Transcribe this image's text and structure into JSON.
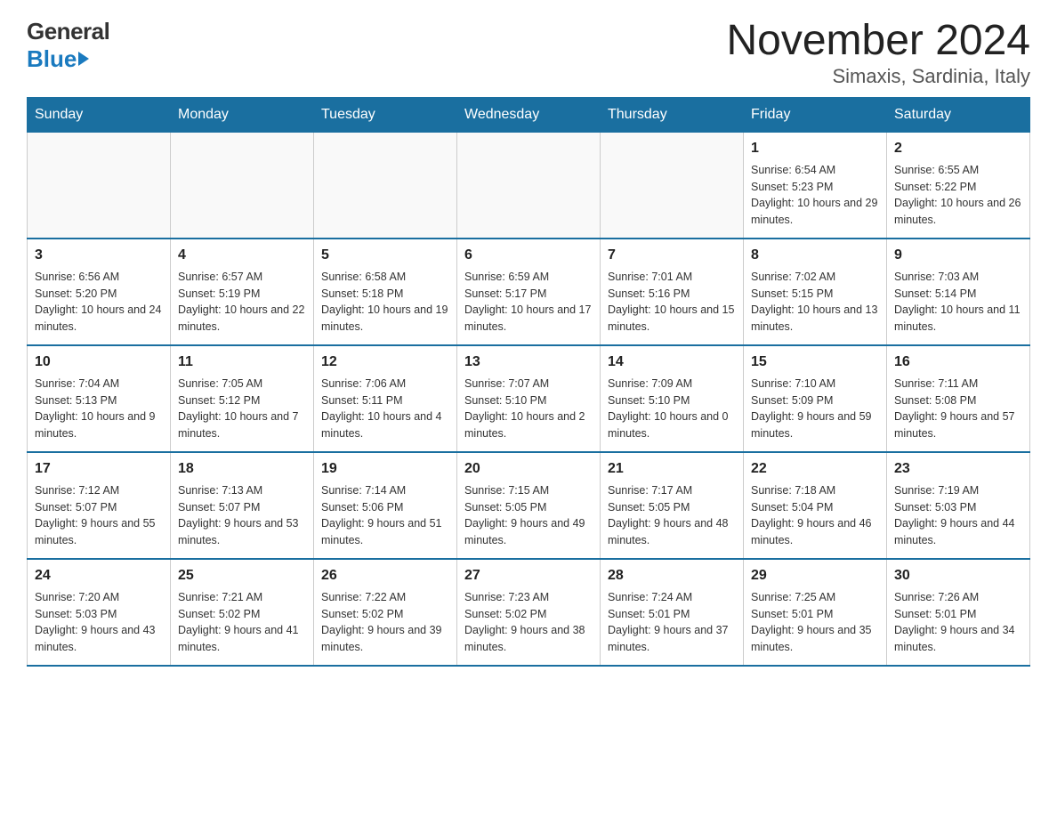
{
  "header": {
    "logo_general": "General",
    "logo_blue": "Blue",
    "month_title": "November 2024",
    "location": "Simaxis, Sardinia, Italy"
  },
  "days_of_week": [
    "Sunday",
    "Monday",
    "Tuesday",
    "Wednesday",
    "Thursday",
    "Friday",
    "Saturday"
  ],
  "weeks": [
    [
      {
        "day": "",
        "info": ""
      },
      {
        "day": "",
        "info": ""
      },
      {
        "day": "",
        "info": ""
      },
      {
        "day": "",
        "info": ""
      },
      {
        "day": "",
        "info": ""
      },
      {
        "day": "1",
        "info": "Sunrise: 6:54 AM\nSunset: 5:23 PM\nDaylight: 10 hours and 29 minutes."
      },
      {
        "day": "2",
        "info": "Sunrise: 6:55 AM\nSunset: 5:22 PM\nDaylight: 10 hours and 26 minutes."
      }
    ],
    [
      {
        "day": "3",
        "info": "Sunrise: 6:56 AM\nSunset: 5:20 PM\nDaylight: 10 hours and 24 minutes."
      },
      {
        "day": "4",
        "info": "Sunrise: 6:57 AM\nSunset: 5:19 PM\nDaylight: 10 hours and 22 minutes."
      },
      {
        "day": "5",
        "info": "Sunrise: 6:58 AM\nSunset: 5:18 PM\nDaylight: 10 hours and 19 minutes."
      },
      {
        "day": "6",
        "info": "Sunrise: 6:59 AM\nSunset: 5:17 PM\nDaylight: 10 hours and 17 minutes."
      },
      {
        "day": "7",
        "info": "Sunrise: 7:01 AM\nSunset: 5:16 PM\nDaylight: 10 hours and 15 minutes."
      },
      {
        "day": "8",
        "info": "Sunrise: 7:02 AM\nSunset: 5:15 PM\nDaylight: 10 hours and 13 minutes."
      },
      {
        "day": "9",
        "info": "Sunrise: 7:03 AM\nSunset: 5:14 PM\nDaylight: 10 hours and 11 minutes."
      }
    ],
    [
      {
        "day": "10",
        "info": "Sunrise: 7:04 AM\nSunset: 5:13 PM\nDaylight: 10 hours and 9 minutes."
      },
      {
        "day": "11",
        "info": "Sunrise: 7:05 AM\nSunset: 5:12 PM\nDaylight: 10 hours and 7 minutes."
      },
      {
        "day": "12",
        "info": "Sunrise: 7:06 AM\nSunset: 5:11 PM\nDaylight: 10 hours and 4 minutes."
      },
      {
        "day": "13",
        "info": "Sunrise: 7:07 AM\nSunset: 5:10 PM\nDaylight: 10 hours and 2 minutes."
      },
      {
        "day": "14",
        "info": "Sunrise: 7:09 AM\nSunset: 5:10 PM\nDaylight: 10 hours and 0 minutes."
      },
      {
        "day": "15",
        "info": "Sunrise: 7:10 AM\nSunset: 5:09 PM\nDaylight: 9 hours and 59 minutes."
      },
      {
        "day": "16",
        "info": "Sunrise: 7:11 AM\nSunset: 5:08 PM\nDaylight: 9 hours and 57 minutes."
      }
    ],
    [
      {
        "day": "17",
        "info": "Sunrise: 7:12 AM\nSunset: 5:07 PM\nDaylight: 9 hours and 55 minutes."
      },
      {
        "day": "18",
        "info": "Sunrise: 7:13 AM\nSunset: 5:07 PM\nDaylight: 9 hours and 53 minutes."
      },
      {
        "day": "19",
        "info": "Sunrise: 7:14 AM\nSunset: 5:06 PM\nDaylight: 9 hours and 51 minutes."
      },
      {
        "day": "20",
        "info": "Sunrise: 7:15 AM\nSunset: 5:05 PM\nDaylight: 9 hours and 49 minutes."
      },
      {
        "day": "21",
        "info": "Sunrise: 7:17 AM\nSunset: 5:05 PM\nDaylight: 9 hours and 48 minutes."
      },
      {
        "day": "22",
        "info": "Sunrise: 7:18 AM\nSunset: 5:04 PM\nDaylight: 9 hours and 46 minutes."
      },
      {
        "day": "23",
        "info": "Sunrise: 7:19 AM\nSunset: 5:03 PM\nDaylight: 9 hours and 44 minutes."
      }
    ],
    [
      {
        "day": "24",
        "info": "Sunrise: 7:20 AM\nSunset: 5:03 PM\nDaylight: 9 hours and 43 minutes."
      },
      {
        "day": "25",
        "info": "Sunrise: 7:21 AM\nSunset: 5:02 PM\nDaylight: 9 hours and 41 minutes."
      },
      {
        "day": "26",
        "info": "Sunrise: 7:22 AM\nSunset: 5:02 PM\nDaylight: 9 hours and 39 minutes."
      },
      {
        "day": "27",
        "info": "Sunrise: 7:23 AM\nSunset: 5:02 PM\nDaylight: 9 hours and 38 minutes."
      },
      {
        "day": "28",
        "info": "Sunrise: 7:24 AM\nSunset: 5:01 PM\nDaylight: 9 hours and 37 minutes."
      },
      {
        "day": "29",
        "info": "Sunrise: 7:25 AM\nSunset: 5:01 PM\nDaylight: 9 hours and 35 minutes."
      },
      {
        "day": "30",
        "info": "Sunrise: 7:26 AM\nSunset: 5:01 PM\nDaylight: 9 hours and 34 minutes."
      }
    ]
  ]
}
